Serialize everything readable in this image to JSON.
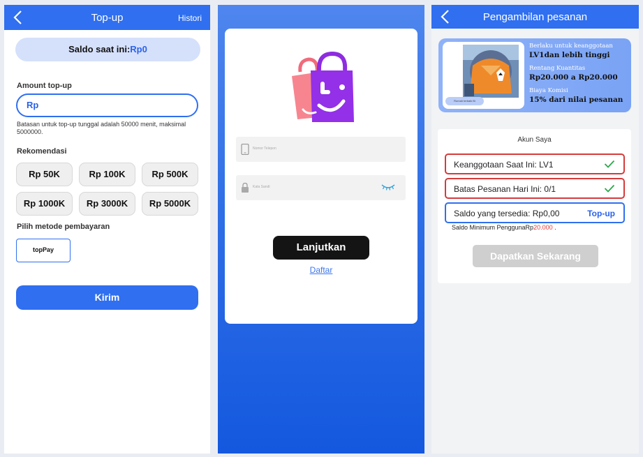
{
  "topup": {
    "header_title": "Top-up",
    "histori_label": "Histori",
    "saldo_label": "Saldo saat ini:",
    "saldo_value": "Rp0",
    "amount_label": "Amount top-up",
    "amount_value": "Rp",
    "limit_note": "Batasan untuk top-up tunggal adalah 50000 menit, maksimal 5000000.",
    "recommend_label": "Rekomendasi",
    "recommendations": [
      "Rp 50K",
      "Rp 100K",
      "Rp 500K",
      "Rp 1000K",
      "Rp 3000K",
      "Rp 5000K"
    ],
    "payment_label": "Pilih metode pembayaran",
    "payment_method": "topPay",
    "submit_label": "Kirim",
    "accent": "#2f6ff0"
  },
  "login": {
    "phone_placeholder": "Nomor Telepon",
    "password_placeholder": "Kata Sandi",
    "continue_label": "Lanjutkan",
    "register_label": "Daftar",
    "continue_color": "#141414"
  },
  "order": {
    "header_title": "Pengambilan pesanan",
    "thumb_caption": "Rumah terbaik Bi",
    "membership_label": "Berlaku untuk keanggotaan",
    "membership_value": "LV1dan lebih tinggi",
    "quantity_label": "Rentang Kuantitas",
    "quantity_value": "Rp20.000 a Rp20.000",
    "commission_label": "Biaya Komisi",
    "commission_value": "15% dari nilai pesanan",
    "account_title": "Akun Saya",
    "membership_row": "Keanggotaan Saat Ini: LV1",
    "limit_row": "Batas Pesanan Hari Ini: 0/1",
    "balance_row": "Saldo yang tersedia: Rp0,00",
    "topup_link": "Top-up",
    "min_balance_text": "Saldo Minimum PenggunaRp",
    "min_balance_value": "20.000",
    "min_balance_suffix": " .",
    "get_now_label": "Dapatkan Sekarang",
    "warn_color": "#d63a3a"
  }
}
